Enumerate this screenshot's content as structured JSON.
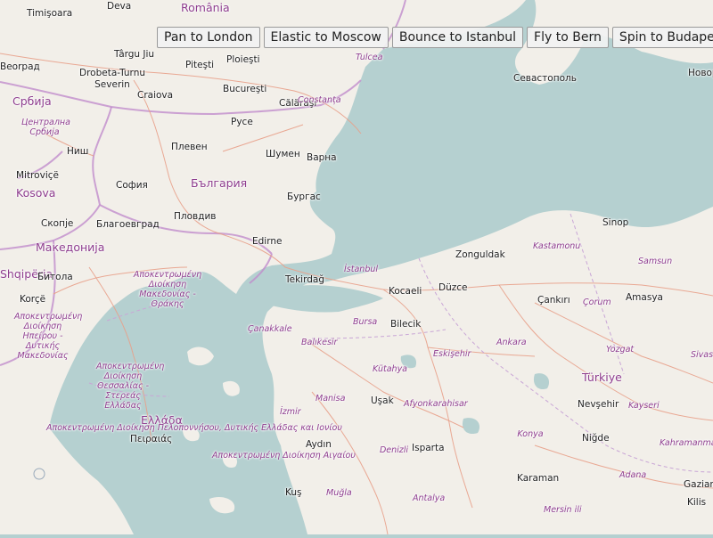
{
  "toolbar": {
    "buttons": [
      {
        "label": "Pan to London"
      },
      {
        "label": "Elastic to Moscow"
      },
      {
        "label": "Bounce to Istanbul"
      },
      {
        "label": "Fly to Bern"
      },
      {
        "label": "Spin to Budapest"
      }
    ]
  },
  "map": {
    "colors": {
      "water": "#b5d0d0",
      "land": "#f2efe9",
      "border": "#c08ccc",
      "road": "#e8a08a",
      "city_text": "#222222",
      "region_text": "#8e3d8e"
    },
    "labels": [
      {
        "text": "Timişoara",
        "kind": "city"
      },
      {
        "text": "Deva",
        "kind": "city"
      },
      {
        "text": "România",
        "kind": "country"
      },
      {
        "text": "Beorpaд",
        "kind": "city"
      },
      {
        "text": "Târgu Jiu",
        "kind": "city"
      },
      {
        "text": "Piteşti",
        "kind": "city"
      },
      {
        "text": "Ploieşti",
        "kind": "city"
      },
      {
        "text": "Tulcea",
        "kind": "region"
      },
      {
        "text": "Drobeta-Turnu Severin",
        "kind": "city"
      },
      {
        "text": "Bucureşti",
        "kind": "city"
      },
      {
        "text": "Севастополь",
        "kind": "city"
      },
      {
        "text": "Новор",
        "kind": "city"
      },
      {
        "text": "Србија",
        "kind": "country"
      },
      {
        "text": "Craiova",
        "kind": "city"
      },
      {
        "text": "Călăraşi",
        "kind": "city"
      },
      {
        "text": "Constanța",
        "kind": "region"
      },
      {
        "text": "Централна Србија",
        "kind": "region"
      },
      {
        "text": "Русе",
        "kind": "city"
      },
      {
        "text": "Плевен",
        "kind": "city"
      },
      {
        "text": "Ниш",
        "kind": "city"
      },
      {
        "text": "Шумен",
        "kind": "city"
      },
      {
        "text": "Варна",
        "kind": "city"
      },
      {
        "text": "Mitroviçë",
        "kind": "city"
      },
      {
        "text": "София",
        "kind": "city"
      },
      {
        "text": "България",
        "kind": "country"
      },
      {
        "text": "Kosova",
        "kind": "country"
      },
      {
        "text": "Бургас",
        "kind": "city"
      },
      {
        "text": "Скопје",
        "kind": "city"
      },
      {
        "text": "Благоевград",
        "kind": "city"
      },
      {
        "text": "Пловдив",
        "kind": "city"
      },
      {
        "text": "Sinop",
        "kind": "city"
      },
      {
        "text": "Kastamonu",
        "kind": "region"
      },
      {
        "text": "Македонија",
        "kind": "country"
      },
      {
        "text": "Edirne",
        "kind": "city"
      },
      {
        "text": "Zonguldak",
        "kind": "city"
      },
      {
        "text": "Samsun",
        "kind": "region"
      },
      {
        "text": "Shqipëria",
        "kind": "country"
      },
      {
        "text": "Битола",
        "kind": "city"
      },
      {
        "text": "Αποκεντρωμένη Διοίκηση Μακεδονίας - Θράκης",
        "kind": "region"
      },
      {
        "text": "İstanbul",
        "kind": "region"
      },
      {
        "text": "Tekirdağ",
        "kind": "city"
      },
      {
        "text": "Korçë",
        "kind": "city"
      },
      {
        "text": "Kocaeli",
        "kind": "city"
      },
      {
        "text": "Düzce",
        "kind": "city"
      },
      {
        "text": "Çankırı",
        "kind": "city"
      },
      {
        "text": "Çorum",
        "kind": "region"
      },
      {
        "text": "Amasya",
        "kind": "city"
      },
      {
        "text": "Αποκεντρωμένη Διοίκηση Ηπείρου - Δυτικής Μακεδονίας",
        "kind": "region"
      },
      {
        "text": "Çanakkale",
        "kind": "region"
      },
      {
        "text": "Bursa",
        "kind": "region"
      },
      {
        "text": "Bilecik",
        "kind": "city"
      },
      {
        "text": "Balıkesir",
        "kind": "region"
      },
      {
        "text": "Ankara",
        "kind": "region"
      },
      {
        "text": "Yozgat",
        "kind": "region"
      },
      {
        "text": "Eskişehir",
        "kind": "region"
      },
      {
        "text": "Sivas",
        "kind": "region"
      },
      {
        "text": "Αποκεντρωμένη Διοίκηση Θεσσαλίας - Στερεάς Ελλάδας",
        "kind": "region"
      },
      {
        "text": "Kütahya",
        "kind": "region"
      },
      {
        "text": "Türkiye",
        "kind": "country"
      },
      {
        "text": "Manisa",
        "kind": "region"
      },
      {
        "text": "Uşak",
        "kind": "city"
      },
      {
        "text": "Afyonkarahisar",
        "kind": "region"
      },
      {
        "text": "Nevşehir",
        "kind": "city"
      },
      {
        "text": "Kayseri",
        "kind": "region"
      },
      {
        "text": "İzmir",
        "kind": "region"
      },
      {
        "text": "Ελλάδα",
        "kind": "country"
      },
      {
        "text": "Αποκεντρωμένη Διοίκηση Πελοποννήσου, Δυτικής Ελλάδας και Ιονίου",
        "kind": "region"
      },
      {
        "text": "Konya",
        "kind": "region"
      },
      {
        "text": "Niğde",
        "kind": "city"
      },
      {
        "text": "Kahramanmara",
        "kind": "region"
      },
      {
        "text": "Πειραιάς",
        "kind": "city"
      },
      {
        "text": "Aydın",
        "kind": "city"
      },
      {
        "text": "Αποκεντρωμένη Διοίκηση Αιγαίου",
        "kind": "region"
      },
      {
        "text": "Denizli",
        "kind": "region"
      },
      {
        "text": "Isparta",
        "kind": "city"
      },
      {
        "text": "Karaman",
        "kind": "city"
      },
      {
        "text": "Adana",
        "kind": "region"
      },
      {
        "text": "Gazian",
        "kind": "city"
      },
      {
        "text": "Kilis",
        "kind": "city"
      },
      {
        "text": "Muğla",
        "kind": "region"
      },
      {
        "text": "Kuş",
        "kind": "city"
      },
      {
        "text": "Antalya",
        "kind": "region"
      },
      {
        "text": "Mersin ili",
        "kind": "region"
      }
    ]
  }
}
